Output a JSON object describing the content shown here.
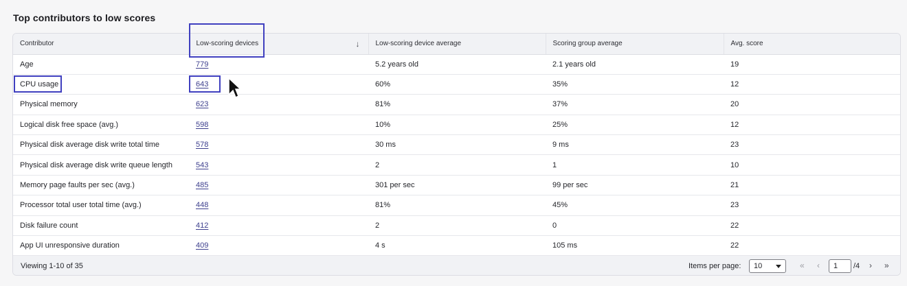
{
  "title": "Top contributors to low scores",
  "table": {
    "headers": [
      "Contributor",
      "Low-scoring devices",
      "Low-scoring device average",
      "Scoring group average",
      "Avg. score"
    ],
    "sort_icon": "arrow-down-icon",
    "rows": [
      {
        "contributor": "Age",
        "devices": "779",
        "device_avg": "5.2 years old",
        "group_avg": "2.1 years old",
        "score": "19"
      },
      {
        "contributor": "CPU usage",
        "devices": "643",
        "device_avg": "60%",
        "group_avg": "35%",
        "score": "12"
      },
      {
        "contributor": "Physical memory",
        "devices": "623",
        "device_avg": "81%",
        "group_avg": "37%",
        "score": "20"
      },
      {
        "contributor": "Logical disk free space (avg.)",
        "devices": "598",
        "device_avg": "10%",
        "group_avg": "25%",
        "score": "12"
      },
      {
        "contributor": "Physical disk average disk write total time",
        "devices": "578",
        "device_avg": "30 ms",
        "group_avg": "9 ms",
        "score": "23"
      },
      {
        "contributor": "Physical disk average disk write queue length",
        "devices": "543",
        "device_avg": "2",
        "group_avg": "1",
        "score": "10"
      },
      {
        "contributor": "Memory page faults per sec (avg.)",
        "devices": "485",
        "device_avg": "301 per sec",
        "group_avg": "99 per sec",
        "score": "21"
      },
      {
        "contributor": "Processor total user total time (avg.)",
        "devices": "448",
        "device_avg": "81%",
        "group_avg": "45%",
        "score": "23"
      },
      {
        "contributor": "Disk failure count",
        "devices": "412",
        "device_avg": "2",
        "group_avg": "0",
        "score": "22"
      },
      {
        "contributor": "App UI unresponsive duration",
        "devices": "409",
        "device_avg": "4 s",
        "group_avg": "105 ms",
        "score": "22"
      }
    ]
  },
  "footer": {
    "viewing": "Viewing 1-10 of 35",
    "items_per_page_label": "Items per page:",
    "items_per_page_value": "10",
    "current_page": "1",
    "total_pages": "/4",
    "first_icon": "«",
    "prev_icon": "‹",
    "next_icon": "›",
    "last_icon": "»"
  },
  "colors": {
    "highlight": "#3f3fbf",
    "link": "#3b3d8c"
  }
}
